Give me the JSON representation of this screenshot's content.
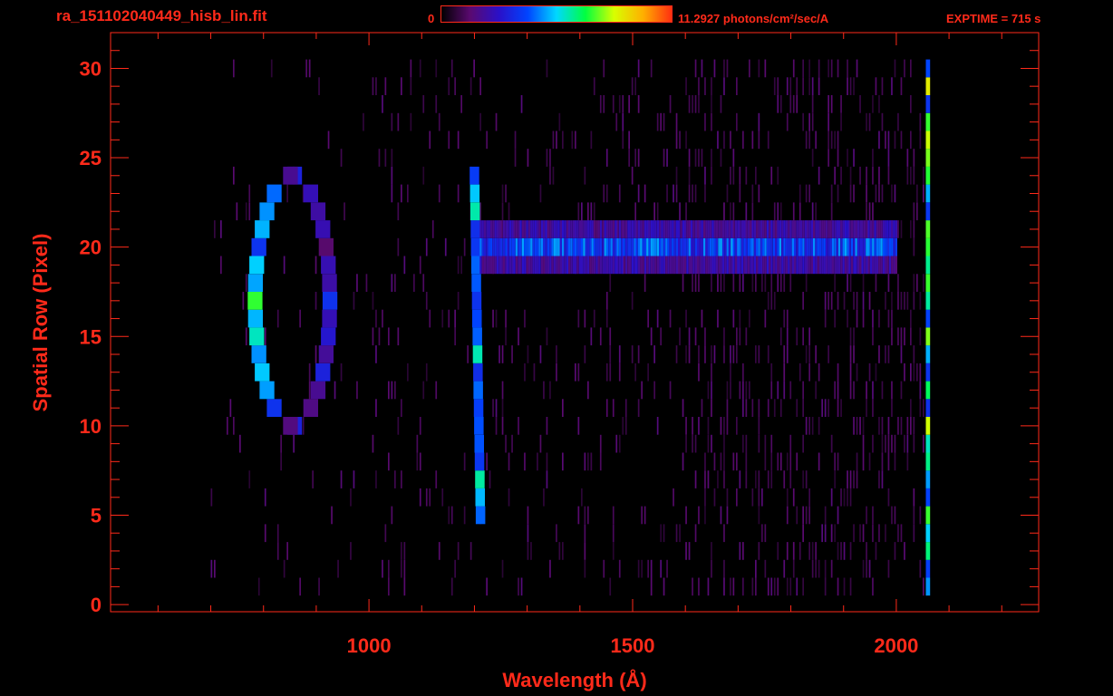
{
  "header": {
    "file_title": "ra_151102040449_hisb_lin.fit",
    "colorbar_min": "0",
    "colorbar_max": "11.2927 photons/cm²/sec/A",
    "exptime": "EXPTIME = 715 s"
  },
  "colors": {
    "axis": "#ff2a1a",
    "background": "#000000",
    "colormap": [
      "#000000",
      "#5a0a70",
      "#2a10c8",
      "#0044ff",
      "#00d8ff",
      "#00ff40",
      "#d8ff00",
      "#ffb000",
      "#ff3010"
    ]
  },
  "chart_data": {
    "type": "heatmap",
    "title": "",
    "xlabel": "Wavelength (Å)",
    "ylabel": "Spatial Row (Pixel)",
    "xlim": [
      510,
      2270
    ],
    "ylim": [
      -0.4,
      32.0
    ],
    "x_ticks": [
      1000,
      1500,
      2000
    ],
    "y_ticks": [
      0,
      5,
      10,
      15,
      20,
      25,
      30
    ],
    "colorbar_range": [
      0,
      11.2927
    ],
    "colorbar_units": "photons/cm²/sec/A",
    "features": [
      {
        "name": "ring",
        "x_range": [
          780,
          930
        ],
        "y_range": [
          10,
          24
        ],
        "peak_value": 7.5
      },
      {
        "name": "vertical line",
        "x": 1205,
        "y_range": [
          5,
          24
        ],
        "peak_value": 6.5
      },
      {
        "name": "horizontal band",
        "x_range": [
          1210,
          2000
        ],
        "y_range": [
          19,
          21
        ],
        "peak_value": 4.0
      },
      {
        "name": "edge line",
        "x": 2060,
        "y_range": [
          1,
          30
        ],
        "peak_value": 9.0
      }
    ]
  }
}
